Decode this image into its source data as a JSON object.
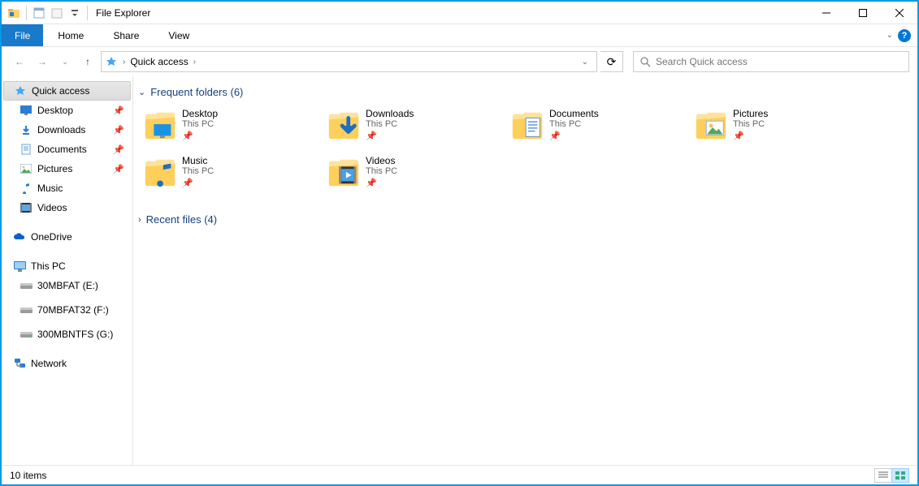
{
  "window": {
    "title": "File Explorer"
  },
  "ribbon": {
    "file": "File",
    "tabs": [
      "Home",
      "Share",
      "View"
    ]
  },
  "address": {
    "crumbs": [
      "Quick access"
    ],
    "search_placeholder": "Search Quick access"
  },
  "sidebar": {
    "quick_access": "Quick access",
    "pinned": [
      {
        "label": "Desktop",
        "icon": "desktop"
      },
      {
        "label": "Downloads",
        "icon": "download"
      },
      {
        "label": "Documents",
        "icon": "document"
      },
      {
        "label": "Pictures",
        "icon": "picture"
      }
    ],
    "freq": [
      {
        "label": "Music",
        "icon": "music"
      },
      {
        "label": "Videos",
        "icon": "video"
      }
    ],
    "onedrive": "OneDrive",
    "thispc": "This PC",
    "drives": [
      {
        "label": "30MBFAT (E:)"
      },
      {
        "label": "70MBFAT32 (F:)"
      },
      {
        "label": "300MBNTFS (G:)"
      }
    ],
    "network": "Network"
  },
  "sections": {
    "frequent": {
      "title": "Frequent folders (6)"
    },
    "recent": {
      "title": "Recent files (4)"
    }
  },
  "folders": [
    {
      "name": "Desktop",
      "sub": "This PC",
      "overlay": "desktop"
    },
    {
      "name": "Downloads",
      "sub": "This PC",
      "overlay": "download"
    },
    {
      "name": "Documents",
      "sub": "This PC",
      "overlay": "document"
    },
    {
      "name": "Pictures",
      "sub": "This PC",
      "overlay": "picture"
    },
    {
      "name": "Music",
      "sub": "This PC",
      "overlay": "music"
    },
    {
      "name": "Videos",
      "sub": "This PC",
      "overlay": "video"
    }
  ],
  "status": {
    "items": "10 items"
  }
}
